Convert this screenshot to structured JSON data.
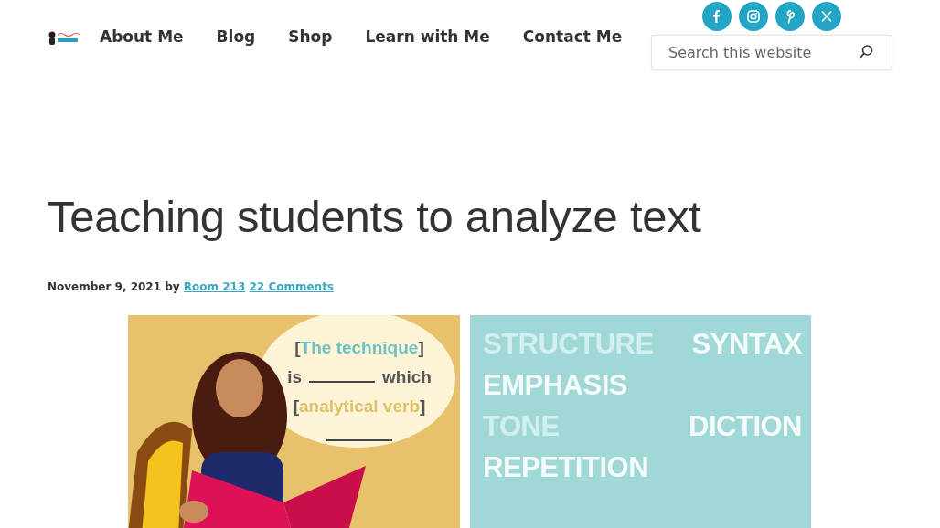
{
  "nav": {
    "items": [
      {
        "label": "About Me"
      },
      {
        "label": "Blog"
      },
      {
        "label": "Shop"
      },
      {
        "label": "Learn with Me"
      },
      {
        "label": "Contact Me"
      }
    ]
  },
  "social": [
    {
      "kind": "facebook"
    },
    {
      "kind": "instagram"
    },
    {
      "kind": "pinterest"
    },
    {
      "kind": "x"
    }
  ],
  "search": {
    "placeholder": "Search this website"
  },
  "post": {
    "title": "Teaching students to analyze text",
    "date": "November 9, 2021",
    "by": "by",
    "author": "Room 213",
    "comments": "22 Comments"
  },
  "featured": {
    "bubble": [
      {
        "parts": [
          {
            "kind": "bracket",
            "text": "["
          },
          {
            "kind": "term",
            "text": "The technique"
          },
          {
            "kind": "bracket",
            "text": "]"
          }
        ]
      },
      {
        "parts": [
          {
            "kind": "plain",
            "text": "is"
          },
          {
            "kind": "blank"
          },
          {
            "kind": "plain",
            "text": "which"
          }
        ]
      },
      {
        "parts": [
          {
            "kind": "bracket",
            "text": "["
          },
          {
            "kind": "verb",
            "text": "analytical verb"
          },
          {
            "kind": "bracket",
            "text": "]"
          }
        ]
      },
      {
        "parts": [
          {
            "kind": "blank"
          }
        ]
      }
    ],
    "words": [
      {
        "items": [
          {
            "text": "STRUCTURE",
            "faded": true
          },
          {
            "text": "SYNTAX",
            "faded": false
          }
        ]
      },
      {
        "items": [
          {
            "text": "EMPHASIS",
            "faded": false
          }
        ]
      },
      {
        "items": [
          {
            "text": "TONE",
            "faded": true
          },
          {
            "text": "DICTION",
            "faded": false
          }
        ]
      },
      {
        "items": [
          {
            "text": "REPETITION",
            "faded": false
          }
        ]
      }
    ]
  }
}
